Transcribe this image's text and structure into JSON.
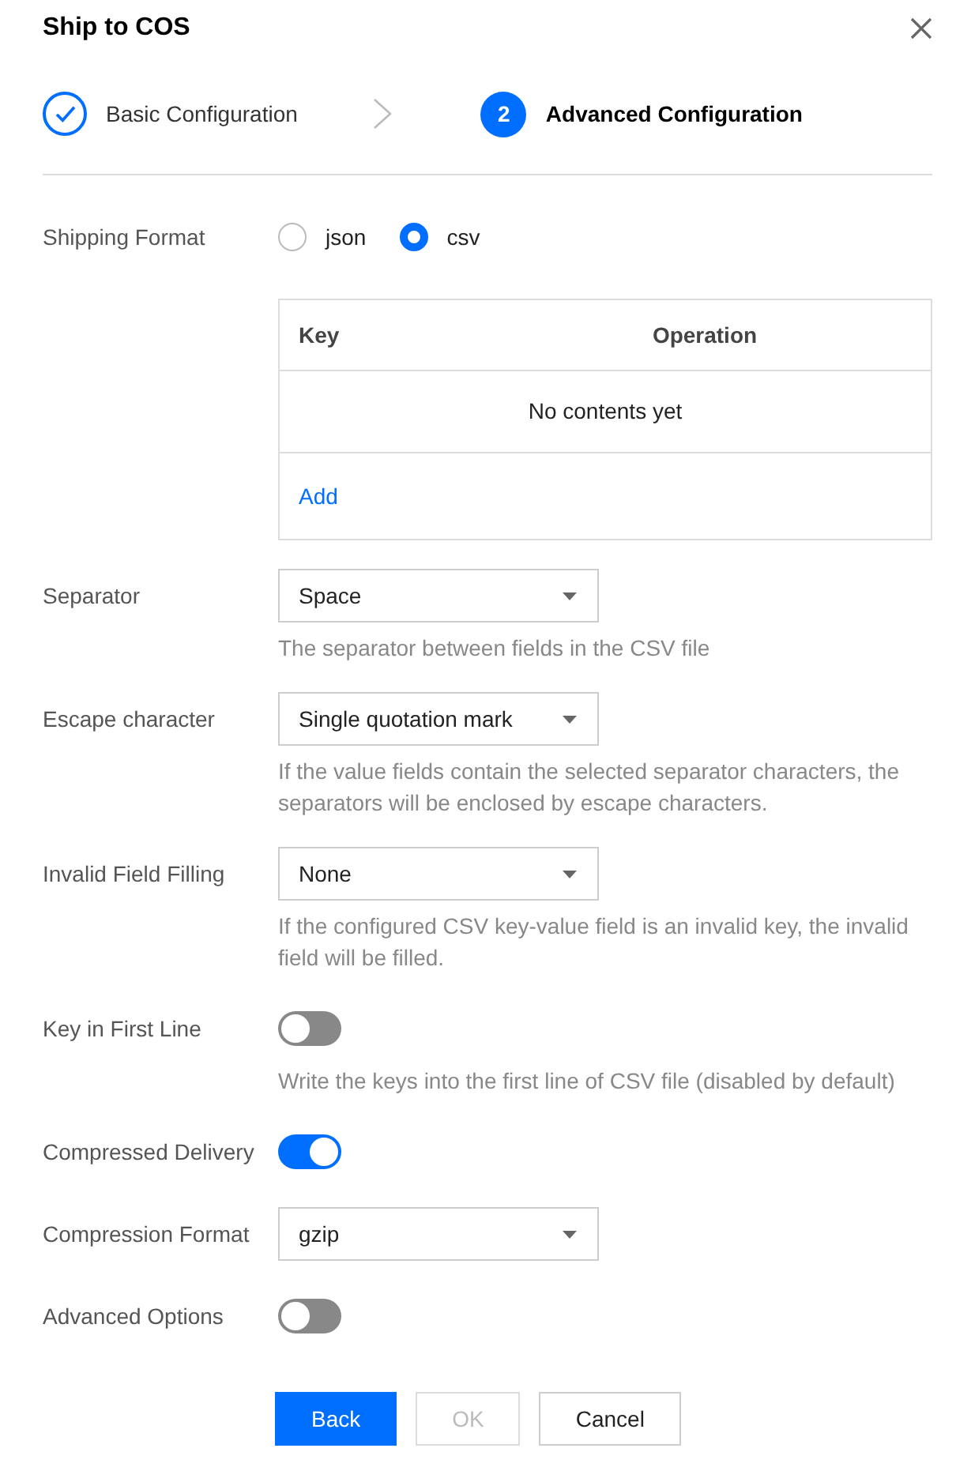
{
  "dialog": {
    "title": "Ship to COS"
  },
  "steps": [
    {
      "kind": "done",
      "label": "Basic Configuration"
    },
    {
      "kind": "current",
      "number": "2",
      "label": "Advanced Configuration"
    }
  ],
  "fields": [
    {
      "kind": "radio",
      "label": "Shipping Format",
      "options": [
        {
          "label": "json",
          "selected": false
        },
        {
          "label": "csv",
          "selected": true
        }
      ]
    },
    {
      "kind": "table",
      "columns": [
        "Key",
        "Operation"
      ],
      "empty": "No contents yet",
      "add": "Add"
    },
    {
      "kind": "select",
      "label": "Separator",
      "value": "Space",
      "help": "The separator between fields in the CSV file"
    },
    {
      "kind": "select",
      "label": "Escape character",
      "value": "Single quotation mark",
      "help": "If the value fields contain the selected separator characters, the separators will be enclosed by escape characters."
    },
    {
      "kind": "select",
      "label": "Invalid Field Filling",
      "value": "None",
      "help": "If the configured CSV key-value field is an invalid key, the invalid field will be filled."
    },
    {
      "kind": "toggle",
      "label": "Key in First Line",
      "on": false,
      "help": "Write the keys into the first line of CSV file (disabled by default)"
    },
    {
      "kind": "toggle",
      "label": "Compressed Delivery",
      "on": true
    },
    {
      "kind": "select",
      "label": "Compression Format",
      "value": "gzip"
    },
    {
      "kind": "toggle",
      "label": "Advanced Options",
      "on": false
    }
  ],
  "buttons": [
    {
      "kind": "primary",
      "label": "Back",
      "disabled": false
    },
    {
      "kind": "default",
      "label": "OK",
      "disabled": true
    },
    {
      "kind": "default",
      "label": "Cancel",
      "disabled": false
    }
  ]
}
